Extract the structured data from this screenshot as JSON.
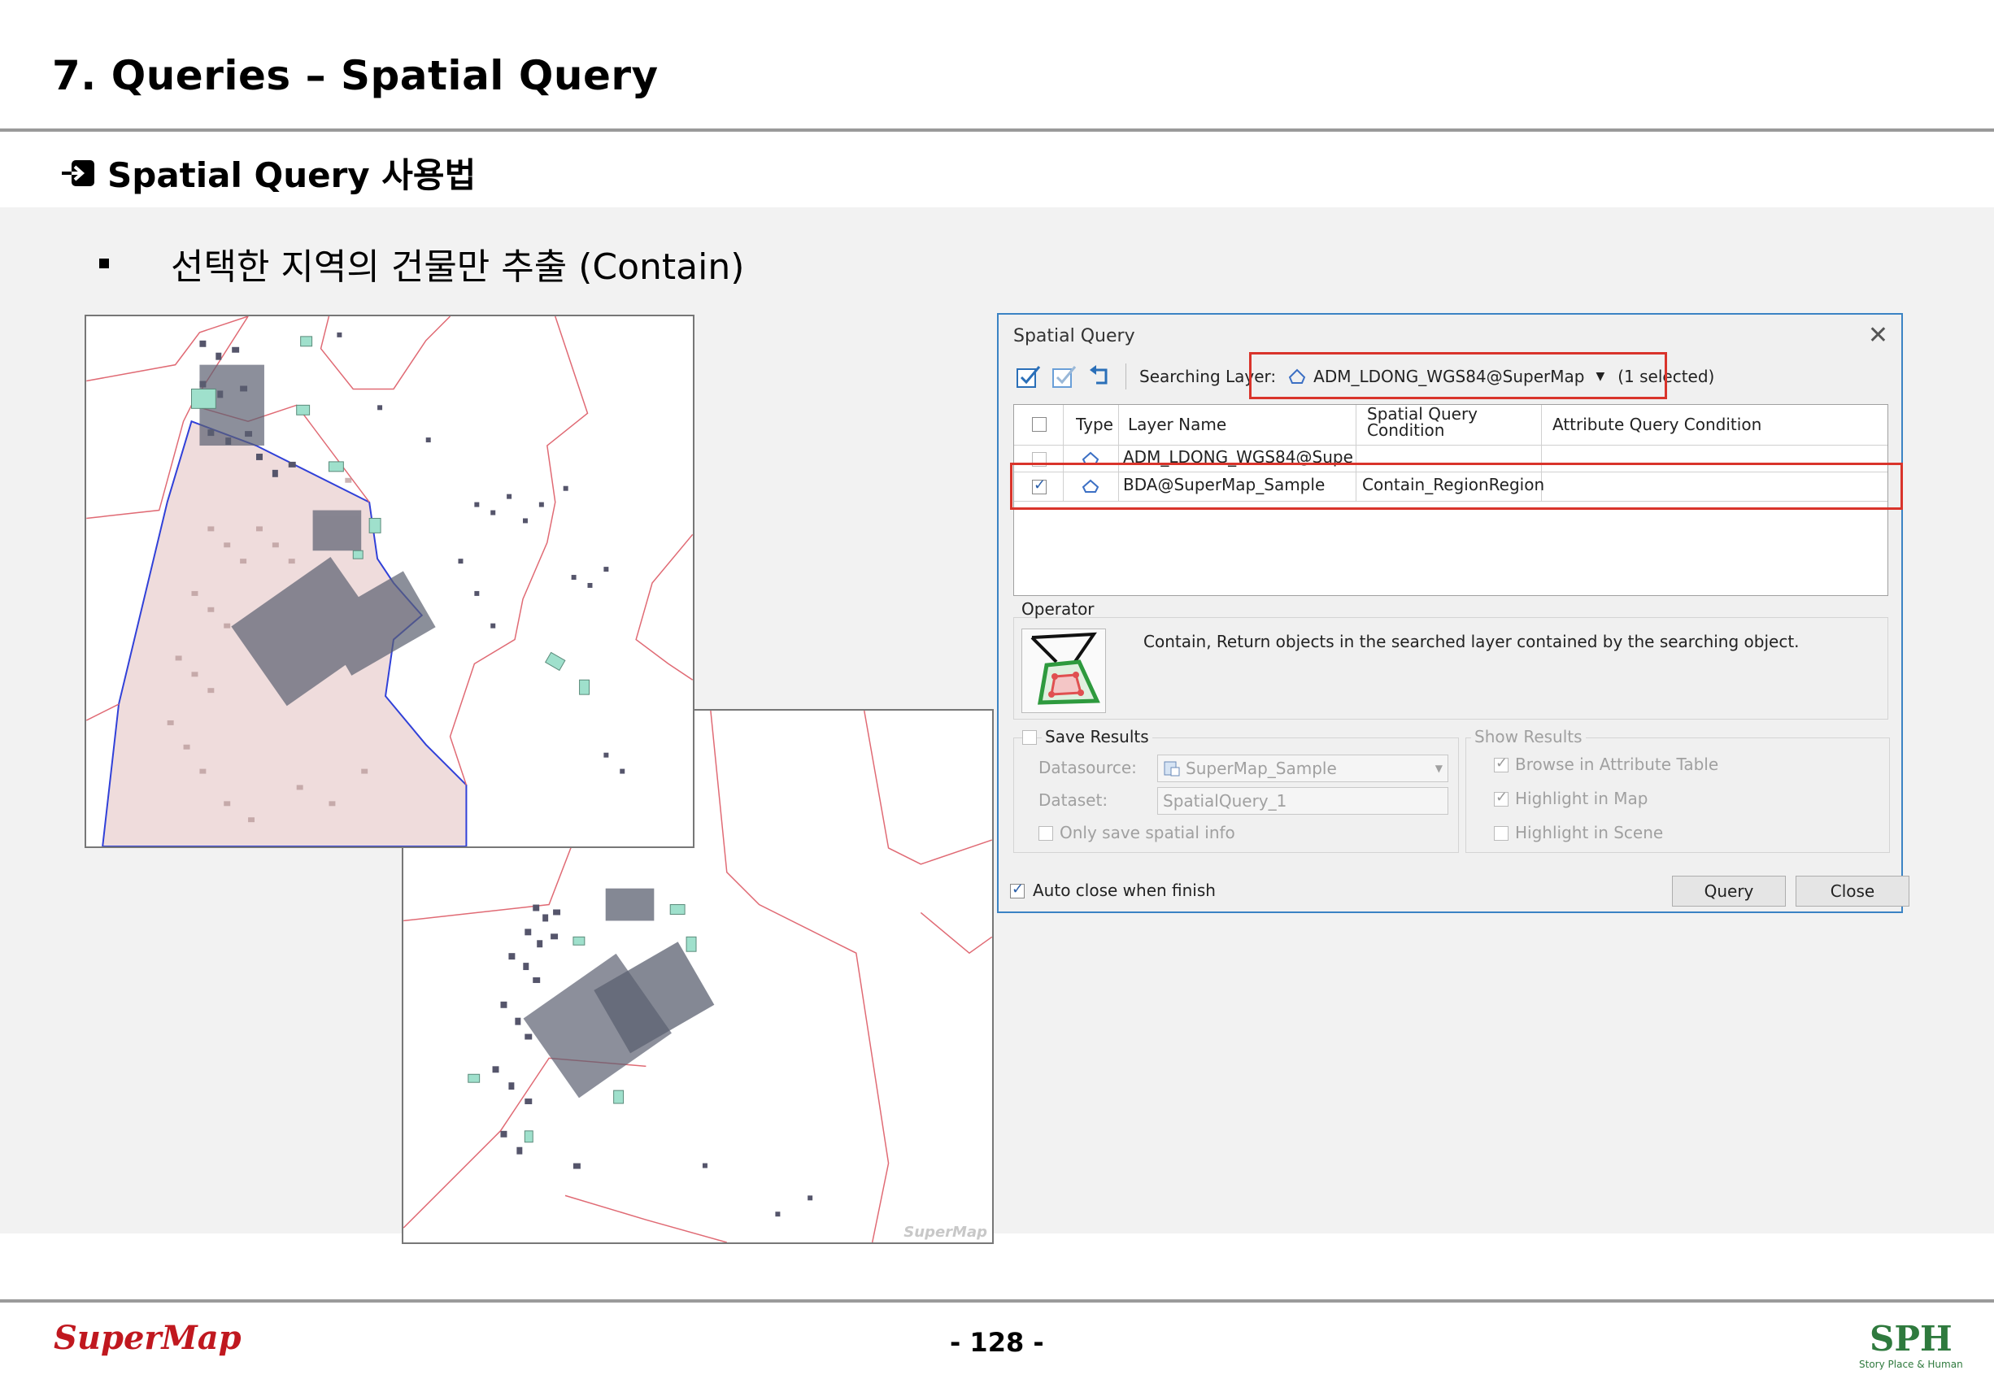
{
  "slide": {
    "title": "7. Queries – Spatial Query",
    "section": "Spatial Query 사용법",
    "bullet": "선택한 지역의 건물만 추출 (Contain)",
    "page_number": "- 128 -"
  },
  "map2": {
    "watermark": "SuperMap"
  },
  "dialog": {
    "title": "Spatial Query",
    "searching_layer_label": "Searching Layer:",
    "searching_layer_value": "ADM_LDONG_WGS84@SuperMap",
    "selected_count": "(1 selected)",
    "columns": [
      "Type",
      "Layer Name",
      "Spatial Query Condition",
      "Attribute Query Condition"
    ],
    "rows": [
      {
        "checked": false,
        "layer": "ADM_LDONG_WGS84@Supe...",
        "condition": "",
        "attr": ""
      },
      {
        "checked": true,
        "layer": "BDA@SuperMap_Sample",
        "condition": "Contain_RegionRegion",
        "attr": ""
      }
    ],
    "operator_label": "Operator",
    "operator_desc": "Contain, Return objects in the searched layer contained by the searching object.",
    "save_results": {
      "label": "Save Results",
      "datasource_label": "Datasource:",
      "datasource_value": "SuperMap_Sample",
      "dataset_label": "Dataset:",
      "dataset_value": "SpatialQuery_1",
      "only_spatial_label": "Only save spatial info"
    },
    "show_results": {
      "label": "Show Results",
      "browse_label": "Browse in Attribute Table",
      "highlight_map_label": "Highlight in Map",
      "highlight_scene_label": "Highlight in Scene"
    },
    "auto_close_label": "Auto close when finish",
    "query_button": "Query",
    "close_button": "Close"
  },
  "logos": {
    "left": "SuperMap",
    "right": "SPH",
    "right_tagline": "Story Place & Human"
  },
  "colors": {
    "accent_blue": "#3b83c4",
    "highlight_red": "#d9342b",
    "region_fill": "#efdcdc",
    "boundary_red": "#e06a74",
    "boundary_blue": "#3040d8"
  }
}
